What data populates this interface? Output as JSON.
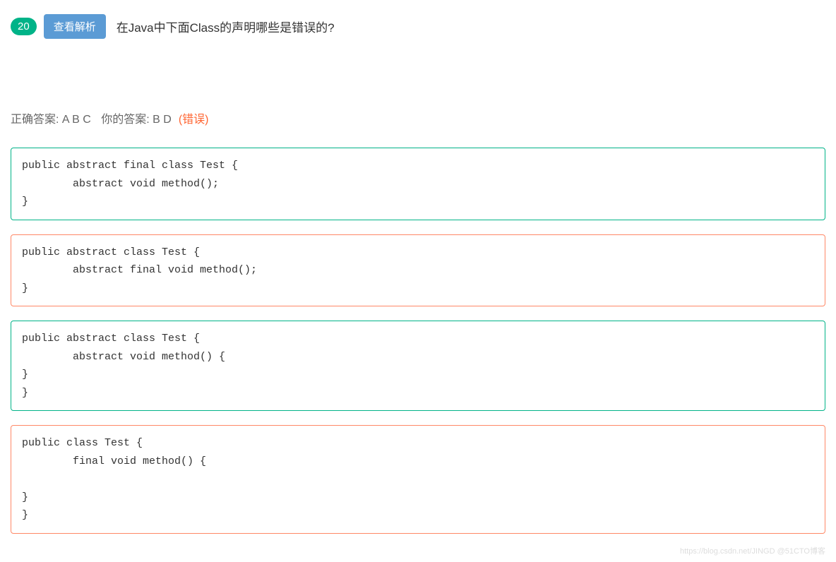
{
  "header": {
    "number": "20",
    "view_analysis": "查看解析",
    "title": "在Java中下面Class的声明哪些是错误的?"
  },
  "answers": {
    "correct_label": "正确答案:",
    "correct_value": "A B C",
    "your_label": "你的答案:",
    "your_value": "B D",
    "wrong": "(错误)"
  },
  "options": [
    {
      "status": "green",
      "code": "public abstract final class Test {\n        abstract void method();\n}"
    },
    {
      "status": "red",
      "code": "public abstract class Test {\n        abstract final void method();\n}"
    },
    {
      "status": "green",
      "code": "public abstract class Test {\n        abstract void method() {\n}\n}"
    },
    {
      "status": "red",
      "code": "public class Test {\n        final void method() {\n\n}\n}"
    }
  ],
  "watermark": "https://blog.csdn.net/JINGD @51CTO博客"
}
